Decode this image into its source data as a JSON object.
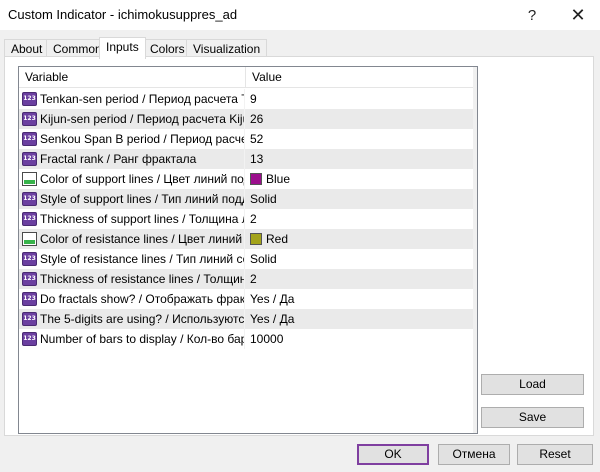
{
  "window": {
    "title": "Custom Indicator - ichimokusuppres_ad",
    "help_glyph": "?",
    "close_glyph": "✕"
  },
  "tabs": [
    {
      "label": "About",
      "active": false
    },
    {
      "label": "Common",
      "active": false
    },
    {
      "label": "Inputs",
      "active": true
    },
    {
      "label": "Colors",
      "active": false
    },
    {
      "label": "Visualization",
      "active": false
    }
  ],
  "grid": {
    "columns": {
      "variable": "Variable",
      "value": "Value"
    },
    "rows": [
      {
        "icon": "numeric-123-icon",
        "variable": "Tenkan-sen period / Период расчета T...",
        "value": "9"
      },
      {
        "icon": "numeric-123-icon",
        "variable": "Kijun-sen period / Период расчета Kiju...",
        "value": "26"
      },
      {
        "icon": "numeric-123-icon",
        "variable": "Senkou Span B period / Период расче...",
        "value": "52"
      },
      {
        "icon": "numeric-123-icon",
        "variable": "Fractal rank / Ранг фрактала",
        "value": "13"
      },
      {
        "icon": "color-palette-icon",
        "variable": "Color of support lines / Цвет линий под...",
        "value": "Blue",
        "swatch": "#9b0e8c"
      },
      {
        "icon": "numeric-123-icon",
        "variable": "Style of support lines / Тип линий подд...",
        "value": "Solid"
      },
      {
        "icon": "numeric-123-icon",
        "variable": "Thickness of support lines / Толщина л...",
        "value": "2"
      },
      {
        "icon": "color-palette-icon",
        "variable": "Color of resistance lines / Цвет линий с...",
        "value": "Red",
        "swatch": "#a3a31a"
      },
      {
        "icon": "numeric-123-icon",
        "variable": "Style of resistance lines / Тип линий со...",
        "value": "Solid"
      },
      {
        "icon": "numeric-123-icon",
        "variable": "Thickness of resistance lines / Толщин...",
        "value": "2"
      },
      {
        "icon": "numeric-123-icon",
        "variable": "Do fractals show? / Отображать фракт...",
        "value": "Yes / Да"
      },
      {
        "icon": "numeric-123-icon",
        "variable": "The 5-digits are using? / Используются...",
        "value": "Yes / Да"
      },
      {
        "icon": "numeric-123-icon",
        "variable": "Number of bars to display / Кол-во баро...",
        "value": "10000"
      }
    ]
  },
  "buttons": {
    "load": "Load",
    "save": "Save",
    "ok": "OK",
    "cancel": "Отмена",
    "reset": "Reset"
  },
  "icon_text": "123",
  "colors": {
    "accent": "#7f3fa0"
  }
}
